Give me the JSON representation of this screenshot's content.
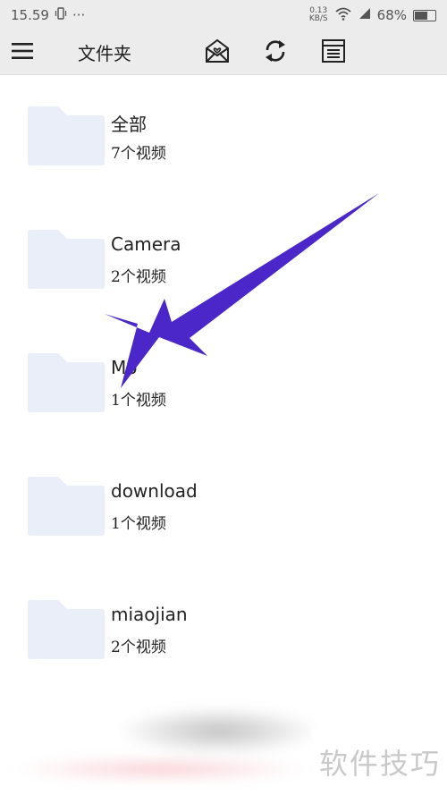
{
  "status_bar": {
    "time": "15.59",
    "dots": "···",
    "net_speed_value": "0.13",
    "net_speed_unit": "KB/S",
    "battery": "68%",
    "battery_level": 0.68
  },
  "app_bar": {
    "title": "文件夹",
    "icons": [
      "menu-icon",
      "envelope-heart-icon",
      "refresh-icon",
      "list-icon"
    ]
  },
  "folders": [
    {
      "name": "全部",
      "count": "7个视频"
    },
    {
      "name": "Camera",
      "count": "2个视频"
    },
    {
      "name": "Mo",
      "count": "1个视频"
    },
    {
      "name": "download",
      "count": "1个视频"
    },
    {
      "name": "miaojian",
      "count": "2个视频"
    }
  ],
  "watermark": "软件技巧",
  "colors": {
    "bar_bg": "#ececec",
    "folder": "#e9eef8",
    "arrow": "#4b27c9"
  }
}
